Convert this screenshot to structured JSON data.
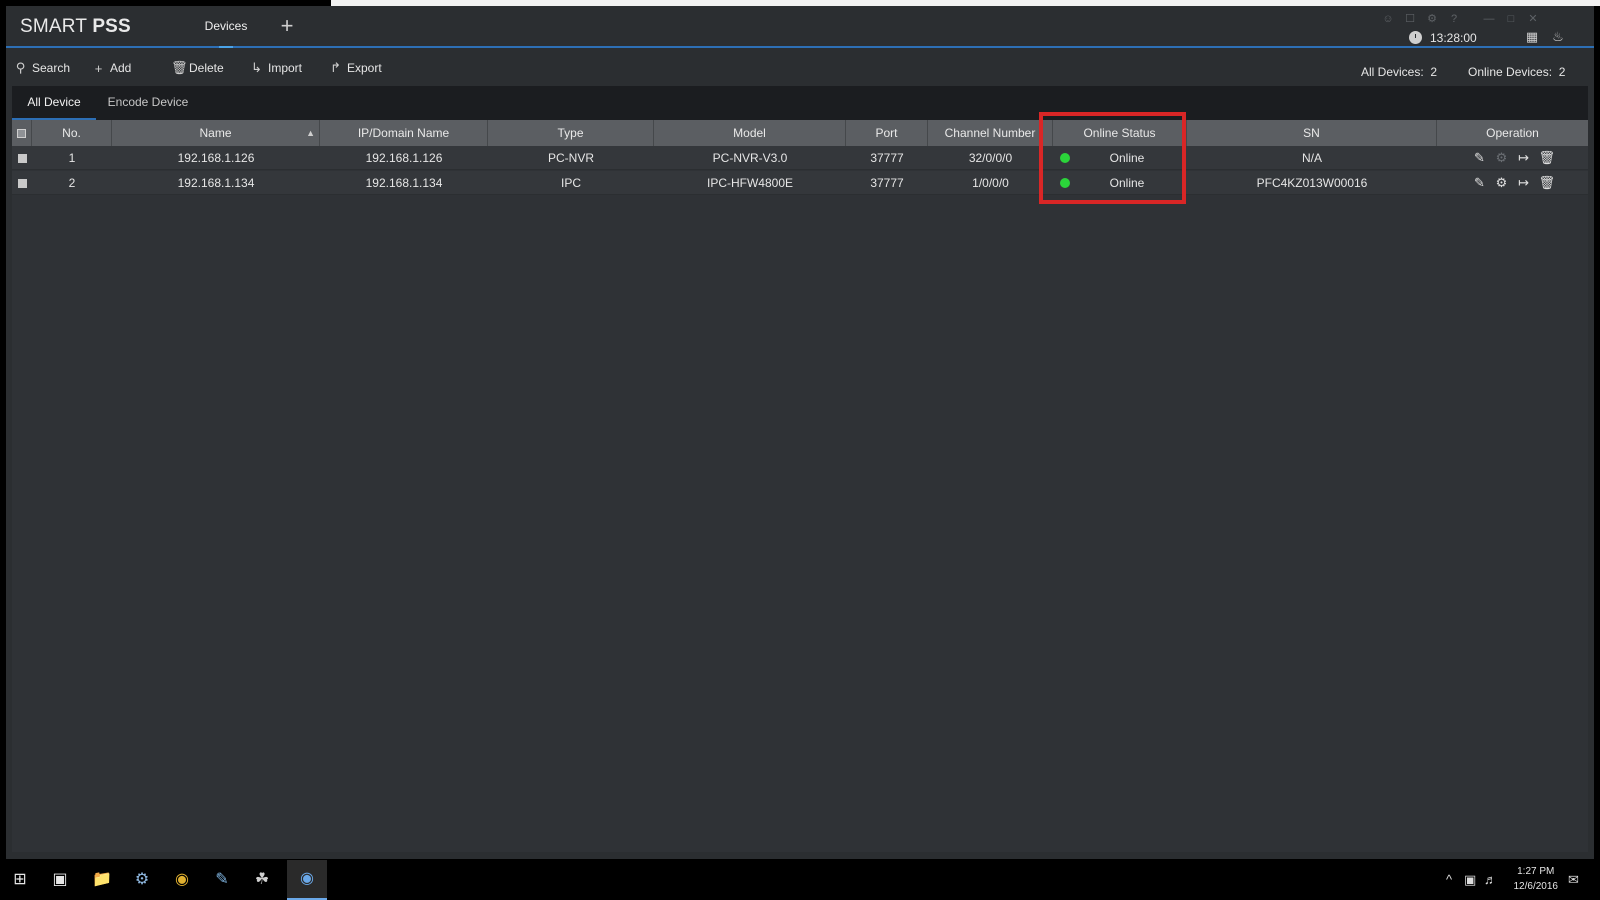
{
  "app": {
    "logo_light": "SMART",
    "logo_bold": "PSS",
    "tab_label": "Devices",
    "add_tab": "+",
    "clock": "13:28:00"
  },
  "toolbar": {
    "search": "Search",
    "add": "Add",
    "delete": "Delete",
    "import": "Import",
    "export": "Export",
    "all_devices_label": "All Devices:",
    "all_devices_count": "2",
    "online_devices_label": "Online Devices:",
    "online_devices_count": "2"
  },
  "subtabs": {
    "all": "All Device",
    "encode": "Encode Device"
  },
  "table": {
    "headers": {
      "no": "No.",
      "name": "Name",
      "ip": "IP/Domain Name",
      "type": "Type",
      "model": "Model",
      "port": "Port",
      "channel": "Channel Number",
      "status": "Online Status",
      "sn": "SN",
      "operation": "Operation"
    },
    "rows": [
      {
        "no": "1",
        "name": "192.168.1.126",
        "ip": "192.168.1.126",
        "type": "PC-NVR",
        "model": "PC-NVR-V3.0",
        "port": "37777",
        "channel": "32/0/0/0",
        "status": "Online",
        "sn": "N/A"
      },
      {
        "no": "2",
        "name": "192.168.1.134",
        "ip": "192.168.1.134",
        "type": "IPC",
        "model": "IPC-HFW4800E",
        "port": "37777",
        "channel": "1/0/0/0",
        "status": "Online",
        "sn": "PFC4KZ013W00016"
      }
    ]
  },
  "taskbar": {
    "time": "1:27 PM",
    "date": "12/6/2016"
  },
  "colors": {
    "accent": "#2d6fb5",
    "online": "#2bd43a",
    "highlight": "#d92626"
  }
}
